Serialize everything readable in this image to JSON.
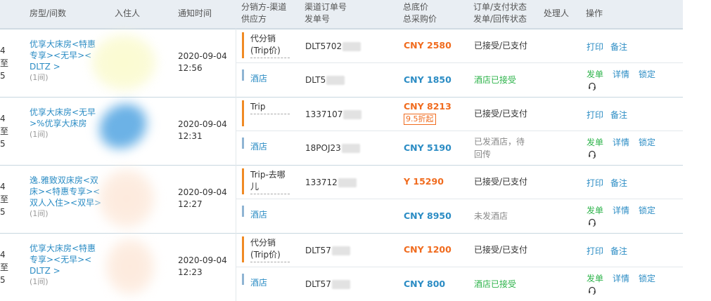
{
  "header": {
    "room_type": "房型/间数",
    "guest": "入住人",
    "notify_time": "通知时间",
    "channel_line1": "分销方-渠道",
    "channel_line2": "供应方",
    "order_line1": "渠道订单号",
    "order_line2": "发单号",
    "price_line1": "总底价",
    "price_line2": "总采购价",
    "status_line1": "订单/支付状态",
    "status_line2": "发单/回传状态",
    "handler": "处理人",
    "actions": "操作"
  },
  "orders": [
    {
      "cutoff_1": "4至",
      "cutoff_2": "5",
      "room_1": "优享大床房<特惠",
      "room_2": "专享><无早><",
      "room_3": "DLTZ >",
      "room_count": "(1间)",
      "time_date": "2020-09-04",
      "time_clock": "12:56",
      "dist_channel_1": "代分销",
      "dist_channel_2": "(Trip价)",
      "supplier": "酒店",
      "channel_order_no": "DLT5702",
      "send_no": "DLT5",
      "total_price": "CNY 2580",
      "discount": "",
      "purchase_price": "CNY 1850",
      "order_status": "已接受/已支付",
      "send_status_1": "酒店已接受",
      "send_status_2": "",
      "top_actions": [
        "打印",
        "备注"
      ],
      "bottom_actions": [
        "发单",
        "详情",
        "锁定"
      ]
    },
    {
      "cutoff_1": "4至",
      "cutoff_2": "5",
      "room_1": "优享大床房<无早",
      "room_2": ">%优享大床房",
      "room_3": "",
      "room_count": "(1间)",
      "time_date": "2020-09-04",
      "time_clock": "12:31",
      "dist_channel_1": "Trip",
      "dist_channel_2": "",
      "supplier": "酒店",
      "channel_order_no": "1337107",
      "send_no": "18POJ23",
      "total_price": "CNY 8213",
      "discount": "9.5折起",
      "purchase_price": "CNY 5190",
      "order_status": "已接受/已支付",
      "send_status_1": "已发酒店，待",
      "send_status_2": "回传",
      "top_actions": [
        "打印",
        "备注"
      ],
      "bottom_actions": [
        "发单",
        "详情",
        "锁定"
      ]
    },
    {
      "cutoff_1": "4至",
      "cutoff_2": "5",
      "room_1": "逸.雅致双床房<双",
      "room_2": "床><特惠专享><",
      "room_3": "双人入住><双早>",
      "room_count": "(1间)",
      "time_date": "2020-09-04",
      "time_clock": "12:27",
      "dist_channel_1": "Trip-去哪",
      "dist_channel_2": "儿",
      "supplier": "酒店",
      "channel_order_no": "133712",
      "send_no": "",
      "total_price": "Y 15290",
      "discount": "",
      "purchase_price": "CNY 8950",
      "order_status": "已接受/已支付",
      "send_status_1": "未发酒店",
      "send_status_2": "",
      "top_actions": [
        "打印",
        "备注"
      ],
      "bottom_actions": [
        "发单",
        "详情",
        "锁定"
      ]
    },
    {
      "cutoff_1": "4至",
      "cutoff_2": "5",
      "room_1": "优享大床房<特惠",
      "room_2": "专享><无早><",
      "room_3": "DLTZ >",
      "room_count": "(1间)",
      "time_date": "2020-09-04",
      "time_clock": "12:23",
      "dist_channel_1": "代分销",
      "dist_channel_2": "(Trip价)",
      "supplier": "酒店",
      "channel_order_no": "DLT57",
      "send_no": "DLT57",
      "total_price": "CNY 1200",
      "discount": "",
      "purchase_price": "CNY 800",
      "order_status": "已接受/已支付",
      "send_status_1": "酒店已接受",
      "send_status_2": "",
      "top_actions": [
        "打印",
        "备注"
      ],
      "bottom_actions": [
        "发单",
        "详情",
        "锁定"
      ]
    }
  ],
  "colors": {
    "link": "#2b8cc4",
    "orange": "#f06b1e",
    "green": "#2db34a",
    "header_bg": "#e9eef3"
  }
}
